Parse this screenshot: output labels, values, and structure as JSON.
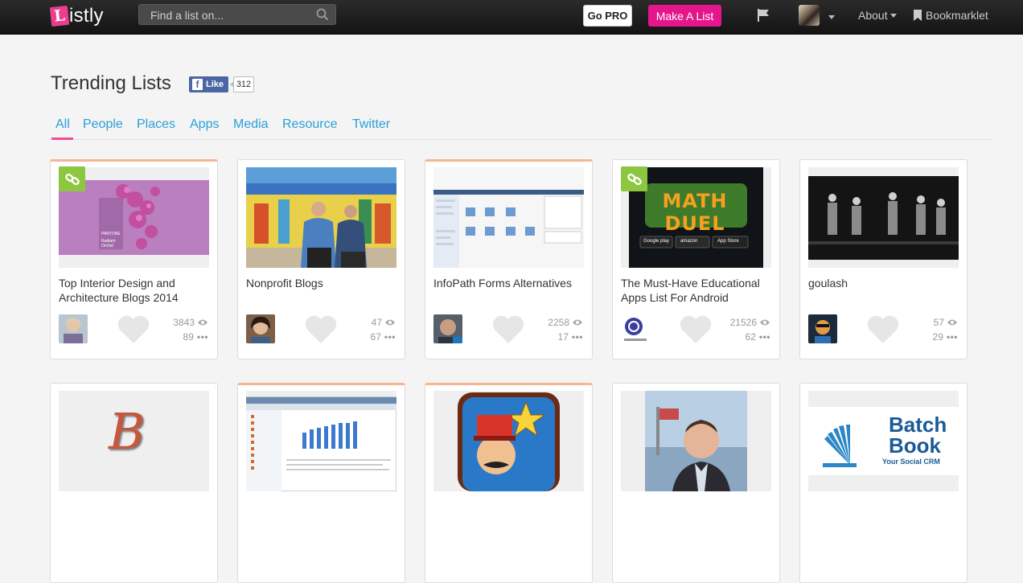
{
  "brand": {
    "logo_letter": "L",
    "logo_text": "istly"
  },
  "nav": {
    "search_placeholder": "Find a list on...",
    "go_pro": "Go PRO",
    "make_list": "Make A List",
    "about": "About",
    "bookmarklet": "Bookmarklet"
  },
  "header": {
    "title": "Trending Lists",
    "fb_like": "Like",
    "fb_count": "312"
  },
  "tabs": [
    {
      "label": "All"
    },
    {
      "label": "People"
    },
    {
      "label": "Places"
    },
    {
      "label": "Apps"
    },
    {
      "label": "Media"
    },
    {
      "label": "Resource"
    },
    {
      "label": "Twitter"
    }
  ],
  "cards": [
    {
      "title": "Top Interior Design and Architecture Blogs 2014",
      "views": "3843",
      "items": "89"
    },
    {
      "title": "Nonprofit Blogs",
      "views": "47",
      "items": "67"
    },
    {
      "title": "InfoPath Forms Alternatives",
      "views": "2258",
      "items": "17"
    },
    {
      "title": "The Must-Have Educational Apps List For Android",
      "views": "21526",
      "items": "62"
    },
    {
      "title": "goulash",
      "views": "57",
      "items": "29"
    }
  ],
  "thumb_text": {
    "pantone": "PANTONE",
    "radiant": "Radiant Orchid",
    "math_duel": "MATH DUEL",
    "google_play": "Google play",
    "amazon": "amazon",
    "app_store": "App Store",
    "batch": "Batch",
    "book": "Book",
    "crm": "Your Social CRM",
    "b_letter": "B"
  },
  "colors": {
    "accent_pink": "#e5168b",
    "tab_blue": "#2a9fd6",
    "link_green": "#8dc63f",
    "hot_orange": "#f7b591"
  }
}
